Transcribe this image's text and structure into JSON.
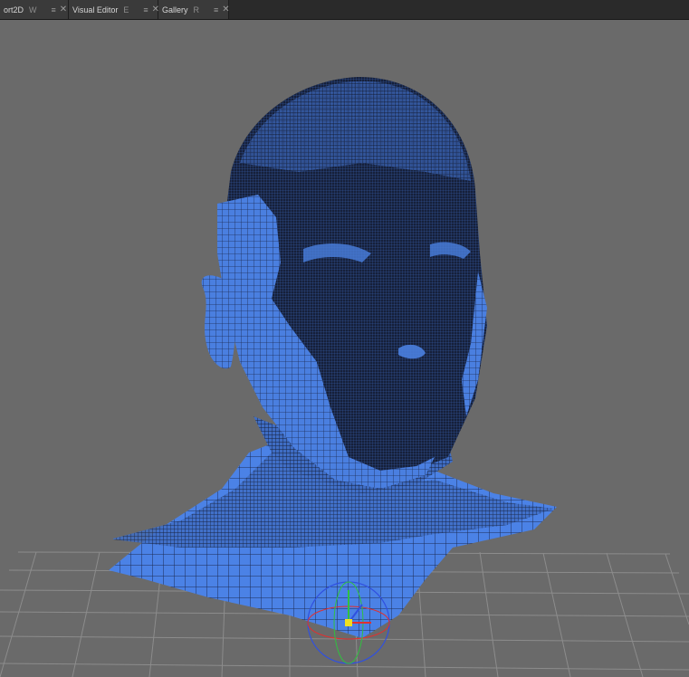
{
  "tabs": [
    {
      "label": "ort2D",
      "hotkey": "W",
      "menu_icon": "menu-icon",
      "close_icon": "close-icon"
    },
    {
      "label": "Visual Editor",
      "hotkey": "E",
      "menu_icon": "menu-icon",
      "close_icon": "close-icon"
    },
    {
      "label": "Gallery",
      "hotkey": "R",
      "menu_icon": "menu-icon",
      "close_icon": "close-icon"
    }
  ],
  "glyphs": {
    "menu": "≡",
    "close": "✕"
  },
  "colors": {
    "viewport_background": "#6a6a6a",
    "mesh_blue": "#4a7fe0",
    "mesh_dark": "#16203a",
    "grid_line": "#8a8a8a",
    "gizmo_x": "#e03030",
    "gizmo_y": "#30c040",
    "gizmo_z": "#3050e0",
    "gizmo_center": "#f0e020"
  }
}
